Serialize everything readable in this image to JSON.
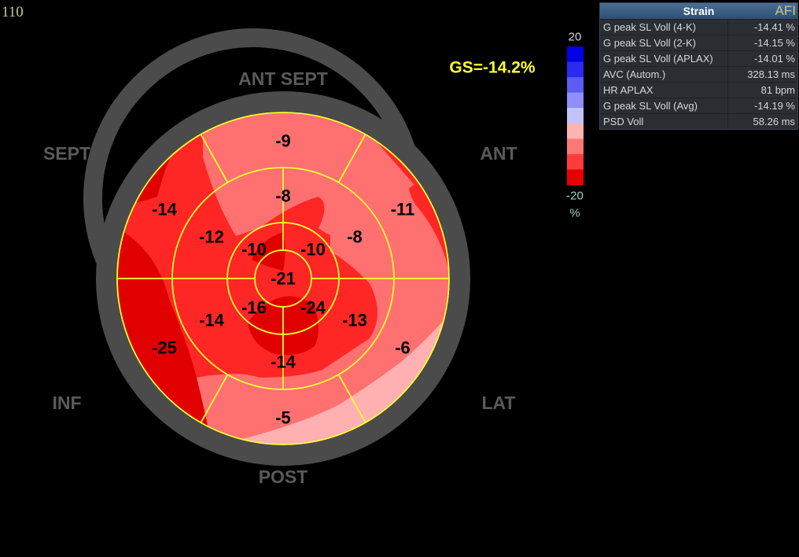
{
  "corner_number": "110",
  "global_strain": "GS=-14.2%",
  "wall_labels": {
    "ant_sept": "ANT SEPT",
    "ant": "ANT",
    "sept": "SEPT",
    "lat": "LAT",
    "inf": "INF",
    "post": "POST"
  },
  "segments": {
    "basal": [
      "-9",
      "-11",
      "-6",
      "-5",
      "-25",
      "-14"
    ],
    "mid": [
      "-8",
      "-8",
      "-13",
      "-14",
      "-14",
      "-12"
    ],
    "apical": [
      "-10",
      "-24",
      "-16",
      "-10"
    ],
    "apex": "-21"
  },
  "color_scale": {
    "max_label": "20",
    "min_label": "-20",
    "unit": "%",
    "colors": [
      "#0000e6",
      "#2a2af0",
      "#5c5cf5",
      "#8f8ff7",
      "#c3c3fa",
      "#ffb3b3",
      "#ff7878",
      "#ff3c3c",
      "#e60000"
    ]
  },
  "colors": {
    "ring": "#4b4b4b",
    "segment_border": "#ffff33",
    "strain_strong": "#e00000",
    "strain_medium": "#ff2626",
    "strain_weak": "#ff7070",
    "strain_weakest": "#ffb0b0"
  },
  "panel": {
    "title": "Strain",
    "badge": "AFI",
    "rows": [
      {
        "name": "G peak SL Voll (4-K)",
        "value": "-14.41 %"
      },
      {
        "name": "G peak SL Voll (2-K)",
        "value": "-14.15 %"
      },
      {
        "name": "G peak SL Voll (APLAX)",
        "value": "-14.01 %"
      },
      {
        "name": "AVC (Autom.)",
        "value": "328.13 ms"
      },
      {
        "name": "HR APLAX",
        "value": "81 bpm"
      },
      {
        "name": "G peak SL Voll (Avg)",
        "value": "-14.19 %"
      },
      {
        "name": "PSD Voll",
        "value": "58.26 ms"
      }
    ]
  }
}
